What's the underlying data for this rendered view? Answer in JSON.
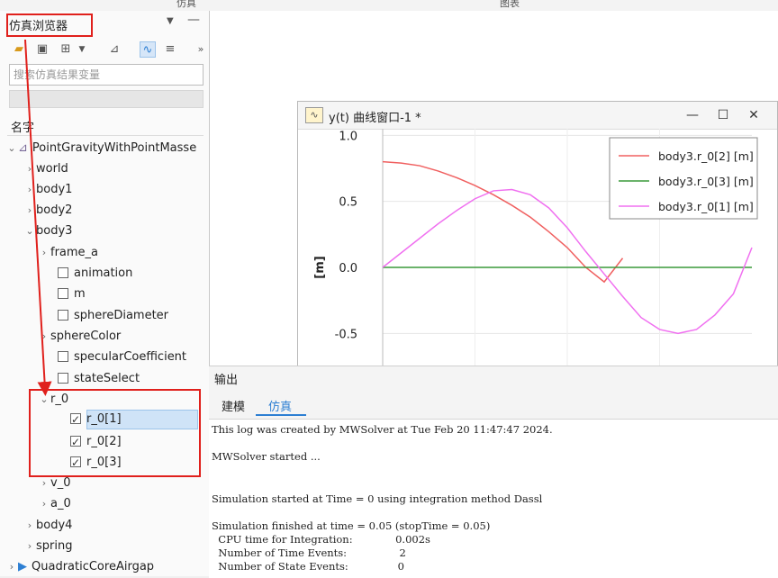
{
  "tabs": {
    "left": "仿真",
    "right": "图表"
  },
  "browser": {
    "title": "仿真浏览器",
    "search_placeholder": "搜索仿真结果变量",
    "name_header": "名字",
    "tree": [
      {
        "label": "PointGravityWithPointMasse",
        "expanded": true,
        "type": "model"
      },
      {
        "label": "world",
        "expanded": false
      },
      {
        "label": "body1",
        "expanded": false
      },
      {
        "label": "body2",
        "expanded": false
      },
      {
        "label": "body3",
        "expanded": true
      },
      {
        "label": "frame_a",
        "expanded": false
      },
      {
        "label": "animation",
        "checked": false
      },
      {
        "label": "m",
        "checked": false
      },
      {
        "label": "sphereDiameter",
        "checked": false
      },
      {
        "label": "sphereColor",
        "expanded": false
      },
      {
        "label": "specularCoefficient",
        "checked": false
      },
      {
        "label": "stateSelect",
        "checked": false
      },
      {
        "label": "r_0",
        "expanded": true
      },
      {
        "label": "r_0[1]",
        "checked": true,
        "selected": true
      },
      {
        "label": "r_0[2]",
        "checked": true
      },
      {
        "label": "r_0[3]",
        "checked": true
      },
      {
        "label": "v_0",
        "expanded": false
      },
      {
        "label": "a_0",
        "expanded": false
      },
      {
        "label": "body4",
        "expanded": false
      },
      {
        "label": "spring",
        "expanded": false
      },
      {
        "label": "QuadraticCoreAirgap",
        "expanded": false,
        "type": "model"
      }
    ]
  },
  "plot_window": {
    "title": "y(t) 曲线窗口-1 *",
    "minimize": "—",
    "maximize": "☐",
    "close": "✕"
  },
  "chart_data": {
    "type": "line",
    "ylabel": "[m]",
    "ylim": [
      -0.75,
      1.05
    ],
    "y_ticks": [
      "1.0",
      "0.5",
      "0.0",
      "-0.5"
    ],
    "grid": true,
    "legend_position": "top-right",
    "series": [
      {
        "name": "body3.r_0[2] [m]",
        "color": "#f06060",
        "x": [
          0,
          0.05,
          0.1,
          0.15,
          0.2,
          0.25,
          0.3,
          0.35,
          0.4,
          0.45,
          0.5,
          0.55,
          0.6,
          0.65
        ],
        "y": [
          0.8,
          0.79,
          0.77,
          0.73,
          0.68,
          0.62,
          0.55,
          0.47,
          0.38,
          0.27,
          0.15,
          0.0,
          -0.11,
          0.07
        ]
      },
      {
        "name": "body3.r_0[3] [m]",
        "color": "#3a9a3a",
        "x": [
          0,
          1.0
        ],
        "y": [
          0.0,
          0.0
        ]
      },
      {
        "name": "body3.r_0[1] [m]",
        "color": "#f070f0",
        "x": [
          0,
          0.05,
          0.1,
          0.15,
          0.2,
          0.25,
          0.3,
          0.35,
          0.4,
          0.45,
          0.5,
          0.55,
          0.6,
          0.65,
          0.7,
          0.75,
          0.8,
          0.85,
          0.9,
          0.95,
          1.0
        ],
        "y": [
          0.0,
          0.11,
          0.22,
          0.33,
          0.43,
          0.52,
          0.58,
          0.59,
          0.55,
          0.45,
          0.3,
          0.12,
          -0.05,
          -0.22,
          -0.38,
          -0.47,
          -0.5,
          -0.47,
          -0.36,
          -0.2,
          0.15
        ]
      }
    ]
  },
  "output": {
    "title": "输出",
    "tabs": [
      "建模",
      "仿真"
    ],
    "active_tab": "仿真",
    "log_lines": [
      "This log was created by MWSolver at Tue Feb 20 11:47:47 2024.",
      "MWSolver started ...",
      "Simulation started at Time = 0 using integration method Dassl",
      "Simulation finished at time = 0.05 (stopTime = 0.05)",
      "  CPU time for Integration:             0.002s",
      "  Number of Time Events:                2",
      "  Number of State Events:               0"
    ]
  },
  "colors": {
    "accent": "#2d7fd3",
    "annotation": "#e0201c",
    "selection": "#cfe3f7"
  }
}
